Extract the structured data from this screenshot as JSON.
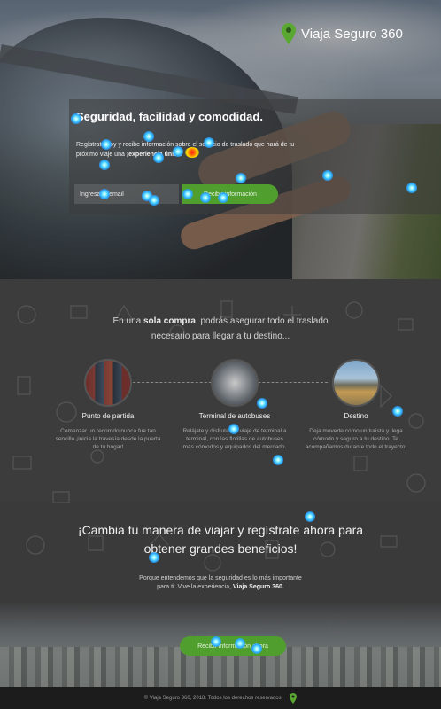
{
  "brand": {
    "name": "Viaja Seguro 360",
    "accent": "#4f9e2e"
  },
  "hero": {
    "title": "Seguridad, facilidad y comodidad.",
    "text_pre": "Regístrate hoy y recibe información sobre el servicio de traslado que hará de tu próximo viaje una ",
    "text_bold": "¡experiencia única!",
    "email_placeholder": "Ingresa tu email",
    "cta_label": "Recibir información"
  },
  "intro": {
    "pre": "En una ",
    "bold": "sola compra",
    "post": ", podrás asegurar todo el traslado",
    "line2": "necesario para llegar a tu destino..."
  },
  "steps": [
    {
      "title": "Punto de partida",
      "desc": "Comenzar un recorrido nunca fue tan sencillo ¡inicia la travesía desde la puerta de tu hogar!"
    },
    {
      "title": "Terminal de autobuses",
      "desc": "Relájate y disfruta del viaje de terminal a terminal, con las flotillas de autobuses más cómodos y equipados del mercado."
    },
    {
      "title": "Destino",
      "desc": "Deja moverte como un turista y llega cómodo y seguro a tu destino. Te acompañamos durante todo el trayecto."
    }
  ],
  "cta": {
    "title_line1": "¡Cambia tu manera de viajar y regístrate ahora para",
    "title_line2": "obtener grandes beneficios!",
    "text_line1": "Porque entendemos que la seguridad es lo más importante",
    "text_line2_pre": "para ti. Vive la experiencia, ",
    "text_line2_bold": "Viaja Seguro 360.",
    "button_label": "Recibir información ahora"
  },
  "footer": {
    "text": "© Viaja Seguro 360, 2018. Todos los derechos reservados."
  },
  "icons": {
    "brand_pin": "map-pin-icon",
    "footer_pin": "map-pin-icon"
  }
}
